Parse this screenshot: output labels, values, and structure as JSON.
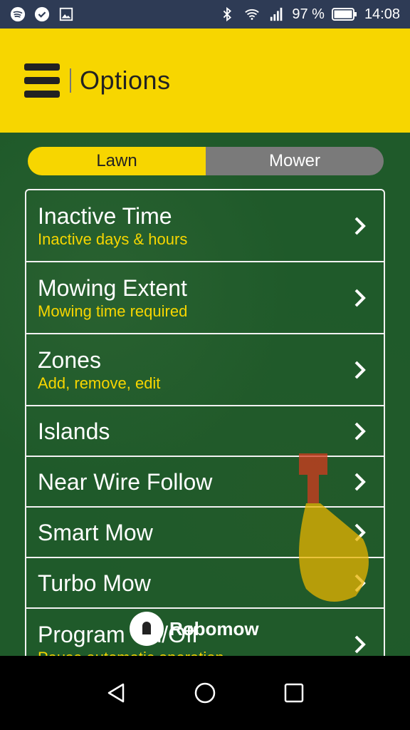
{
  "status_bar": {
    "battery_percent": "97 %",
    "time": "14:08",
    "icons": [
      "spotify-icon",
      "check-circle-icon",
      "image-icon",
      "bluetooth-icon",
      "wifi-icon",
      "signal-icon",
      "battery-icon"
    ]
  },
  "header": {
    "title": "Options",
    "menu_icon": "hamburger-menu-icon"
  },
  "tabs": [
    {
      "label": "Lawn",
      "active": true
    },
    {
      "label": "Mower",
      "active": false
    }
  ],
  "options": [
    {
      "title": "Inactive Time",
      "subtitle": "Inactive days & hours"
    },
    {
      "title": "Mowing Extent",
      "subtitle": "Mowing time required"
    },
    {
      "title": "Zones",
      "subtitle": "Add, remove, edit"
    },
    {
      "title": "Islands",
      "subtitle": ""
    },
    {
      "title": "Near Wire Follow",
      "subtitle": ""
    },
    {
      "title": "Smart Mow",
      "subtitle": ""
    },
    {
      "title": "Turbo Mow",
      "subtitle": ""
    },
    {
      "title": "Program On/Off",
      "subtitle": "Pause automatic operation"
    }
  ],
  "overlay": {
    "logo_text": "Robomow"
  },
  "colors": {
    "accent_yellow": "#f7d600",
    "grass_green": "#1f5a2a",
    "status_bar": "#2e3b55",
    "inactive_tab": "#7a7a7a"
  },
  "nav": [
    "back-icon",
    "home-icon",
    "recents-icon"
  ]
}
